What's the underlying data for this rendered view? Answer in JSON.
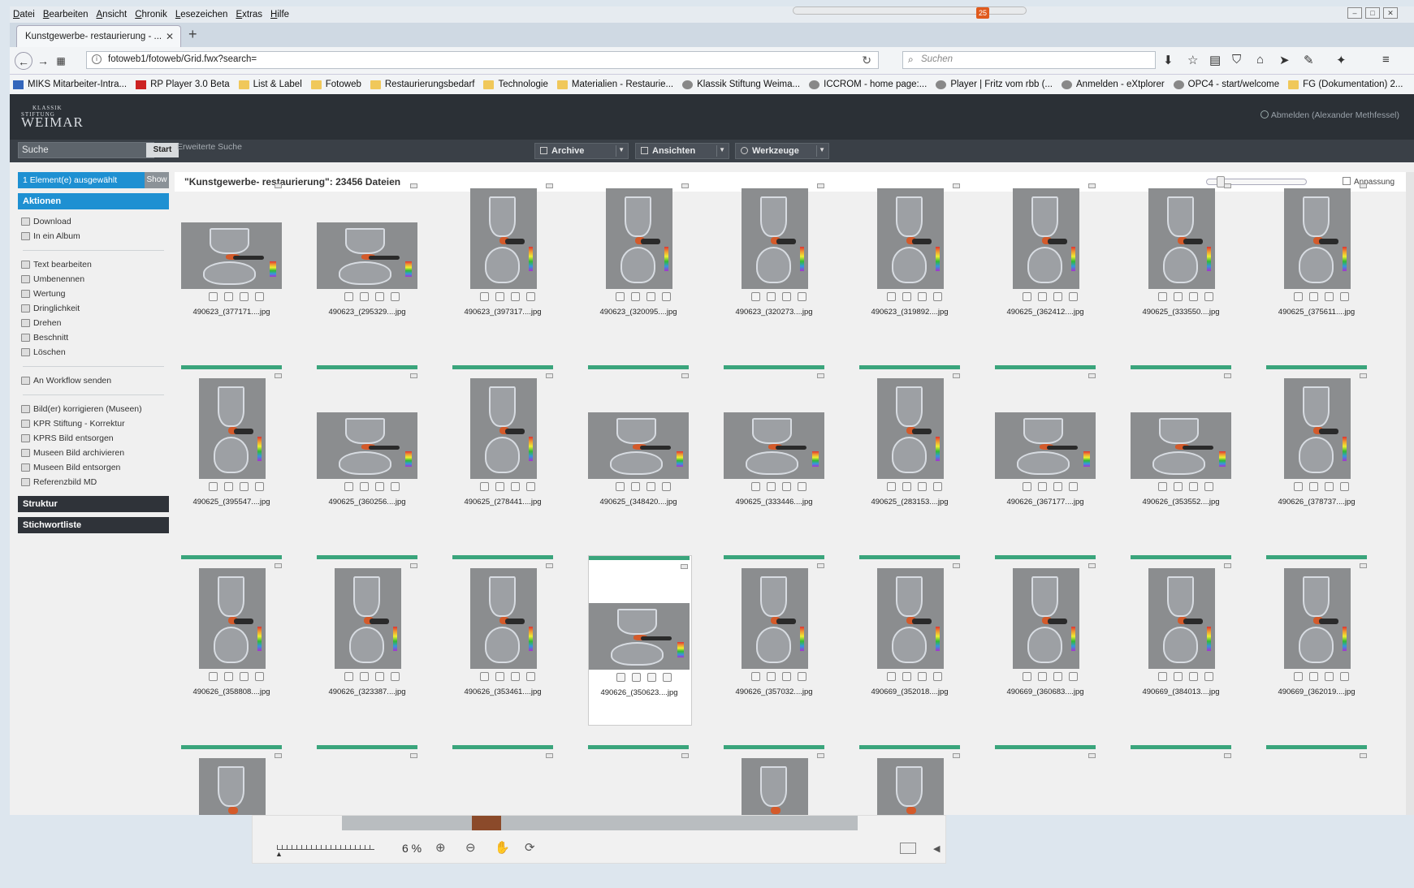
{
  "browser": {
    "menu": [
      "Datei",
      "Bearbeiten",
      "Ansicht",
      "Chronik",
      "Lesezeichen",
      "Extras",
      "Hilfe"
    ],
    "download_badge": "25",
    "tab_title": "Kunstgewerbe- restaurierung - ...",
    "url": "fotoweb1/fotoweb/Grid.fwx?search=",
    "search_placeholder": "Suchen",
    "bookmarks": [
      {
        "label": "MIKS Mitarbeiter-Intra...",
        "icon": "blue"
      },
      {
        "label": "RP Player 3.0 Beta",
        "icon": "red"
      },
      {
        "label": "List & Label",
        "icon": "folder"
      },
      {
        "label": "Fotoweb",
        "icon": "folder"
      },
      {
        "label": "Restaurierungsbedarf",
        "icon": "folder"
      },
      {
        "label": "Technologie",
        "icon": "folder"
      },
      {
        "label": "Materialien - Restaurie...",
        "icon": "folder"
      },
      {
        "label": "Klassik Stiftung Weima...",
        "icon": "globe"
      },
      {
        "label": "ICCROM - home page:...",
        "icon": "globe"
      },
      {
        "label": "Player | Fritz vom rbb (...",
        "icon": "globe"
      },
      {
        "label": "Anmelden - eXtplorer",
        "icon": "globe"
      },
      {
        "label": "OPC4 - start/welcome",
        "icon": "globe"
      },
      {
        "label": "FG (Dokumentation) 2...",
        "icon": "folder"
      }
    ]
  },
  "app": {
    "logo_top": "KLASSIK",
    "logo_mid": "STIFTUNG",
    "logo_main": "WEIMAR",
    "logout": "Abmelden (Alexander Methfessel)",
    "search_value": "Suche",
    "start_label": "Start",
    "ext_search": "Erweiterte Suche",
    "menus": {
      "archive": "Archive",
      "views": "Ansichten",
      "tools": "Werkzeuge"
    }
  },
  "sidebar": {
    "selected": "1 Element(e) ausgewählt",
    "show": "Show",
    "actions_title": "Aktionen",
    "group1": [
      "Download",
      "In ein Album"
    ],
    "group2": [
      "Text bearbeiten",
      "Umbenennen",
      "Wertung",
      "Dringlichkeit",
      "Drehen",
      "Beschnitt",
      "Löschen"
    ],
    "group3": [
      "An Workflow senden"
    ],
    "group4": [
      "Bild(er) korrigieren (Museen)",
      "KPR Stiftung - Korrektur",
      "KPRS Bild entsorgen",
      "Museen Bild archivieren",
      "Museen Bild entsorgen",
      "Referenzbild MD"
    ],
    "structure": "Struktur",
    "keywords": "Stichwortliste"
  },
  "main": {
    "title": "\"Kunstgewerbe- restaurierung\": 23456 Dateien",
    "fit_label": "Anpassung",
    "files": [
      "490623_(377171....jpg",
      "490623_(295329....jpg",
      "490623_(397317....jpg",
      "490623_(320095....jpg",
      "490623_(320273....jpg",
      "490623_(319892....jpg",
      "490625_(362412....jpg",
      "490625_(333550....jpg",
      "490625_(375611....jpg",
      "490625_(395547....jpg",
      "490625_(360256....jpg",
      "490625_(278441....jpg",
      "490625_(348420....jpg",
      "490625_(333446....jpg",
      "490625_(283153....jpg",
      "490626_(367177....jpg",
      "490626_(353552....jpg",
      "490626_(378737....jpg",
      "490626_(358808....jpg",
      "490626_(323387....jpg",
      "490626_(353461....jpg",
      "490626_(350623....jpg",
      "490626_(357032....jpg",
      "490669_(352018....jpg",
      "490669_(360683....jpg",
      "490669_(384013....jpg",
      "490669_(362019....jpg"
    ]
  },
  "viewer": {
    "zoom": "6 %"
  }
}
